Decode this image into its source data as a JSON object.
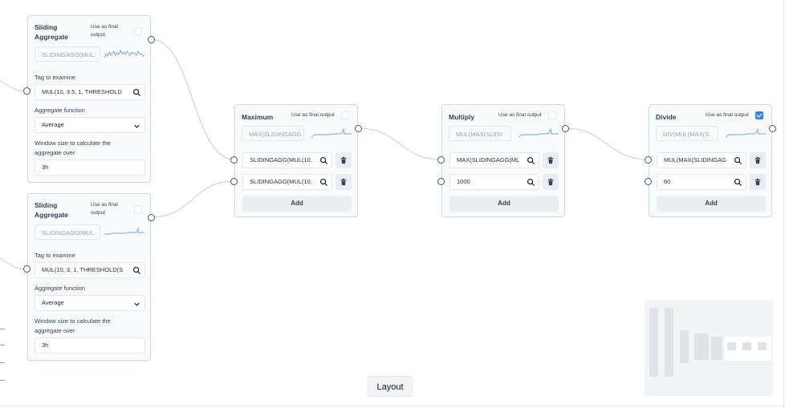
{
  "layout_button": "Layout",
  "nodes": {
    "sliding1": {
      "title_line1": "Sliding",
      "title_line2": "Aggregate",
      "final_line1": "Use as final",
      "final_line2": "output",
      "final_checked": false,
      "preview": "SLIDINGAGG(MUL",
      "tag_label": "Tag to examine",
      "tag_value": "MUL(10, 3.5, 1, THRESHOLD",
      "func_label": "Aggregate function",
      "func_value": "Average",
      "window_label_line1": "Window size to calculate the",
      "window_label_line2": "aggregate over",
      "window_value": "3h"
    },
    "sliding2": {
      "title_line1": "Sliding",
      "title_line2": "Aggregate",
      "final_line1": "Use as final",
      "final_line2": "output",
      "final_checked": false,
      "preview": "SLIDINGAGG(MUL",
      "tag_label": "Tag to examine",
      "tag_value": "MUL(10, 3, 1, THRESHOLD(S",
      "func_label": "Aggregate function",
      "func_value": "Average",
      "window_label_line1": "Window size to calculate the",
      "window_label_line2": "aggregate over",
      "window_value": "3h"
    },
    "maximum": {
      "title": "Maximum",
      "final_label": "Use as final output",
      "final_checked": false,
      "preview": "MAX(SLIDINGAGG",
      "inputs": [
        "SLIDINGAGG(MUL(10,",
        "SLIDINGAGG(MUL(10,"
      ],
      "add_label": "Add"
    },
    "multiply": {
      "title": "Multiply",
      "final_label": "Use as final output",
      "final_checked": false,
      "preview": "MUL(MAX(SLIDII",
      "inputs": [
        "MAX(SLIDINGAGG(ML",
        "1000"
      ],
      "add_label": "Add"
    },
    "divide": {
      "title": "Divide",
      "final_label": "Use as final output",
      "final_checked": true,
      "preview": "DIV(MUL(MAX(S",
      "inputs": [
        "MUL(MAX(SLIDINGAG",
        "60"
      ],
      "add_label": "Add"
    }
  },
  "icons": {
    "search": "search-icon",
    "trash": "trash-icon",
    "chevron": "chevron-down-icon",
    "check": "check-icon"
  },
  "colors": {
    "accent": "#3b82f6",
    "sparkline": "#6ea8d8",
    "node_border": "#d4dae3",
    "edge": "#c7cdd4"
  }
}
